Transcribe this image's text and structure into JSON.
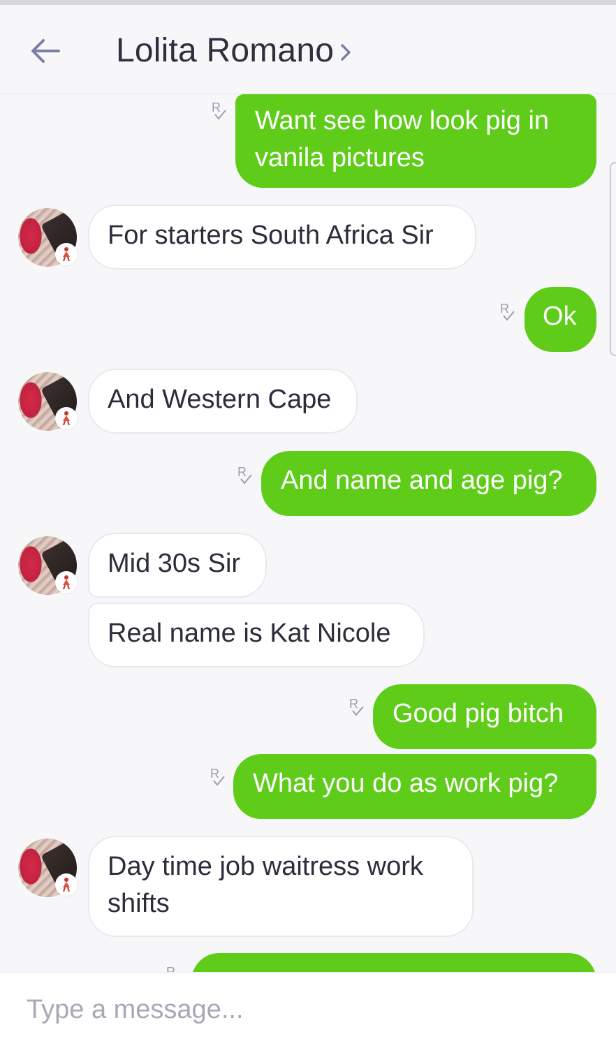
{
  "header": {
    "title": "Lolita Romano",
    "back_icon": "arrow-left-icon",
    "chevron_icon": "chevron-right-icon"
  },
  "messages": [
    {
      "from": "me",
      "text": "Want see how look pig in vanila pictures",
      "receipt": "R"
    },
    {
      "from": "them",
      "text": "For starters South Africa Sir"
    },
    {
      "from": "me",
      "text": "Ok",
      "receipt": "R"
    },
    {
      "from": "them",
      "text": "And Western Cape"
    },
    {
      "from": "me",
      "text": "And name and age pig?",
      "receipt": "R"
    },
    {
      "from": "them",
      "text": "Mid 30s Sir"
    },
    {
      "from": "them",
      "text": "Real name is Kat Nicole"
    },
    {
      "from": "me",
      "text": "Good pig bitch",
      "receipt": "R"
    },
    {
      "from": "me",
      "text": "What you do as work pig?",
      "receipt": "R"
    },
    {
      "from": "them",
      "text": "Day time job waitress work shifts"
    },
    {
      "from": "me",
      "text": "",
      "receipt": "R"
    }
  ],
  "composer": {
    "placeholder": "Type a message..."
  },
  "colors": {
    "outgoing_bubble": "#5fcc1a",
    "incoming_bubble": "#ffffff",
    "background": "#f7f7f9",
    "header_text": "#2f2f40",
    "icon": "#7b80a6"
  }
}
